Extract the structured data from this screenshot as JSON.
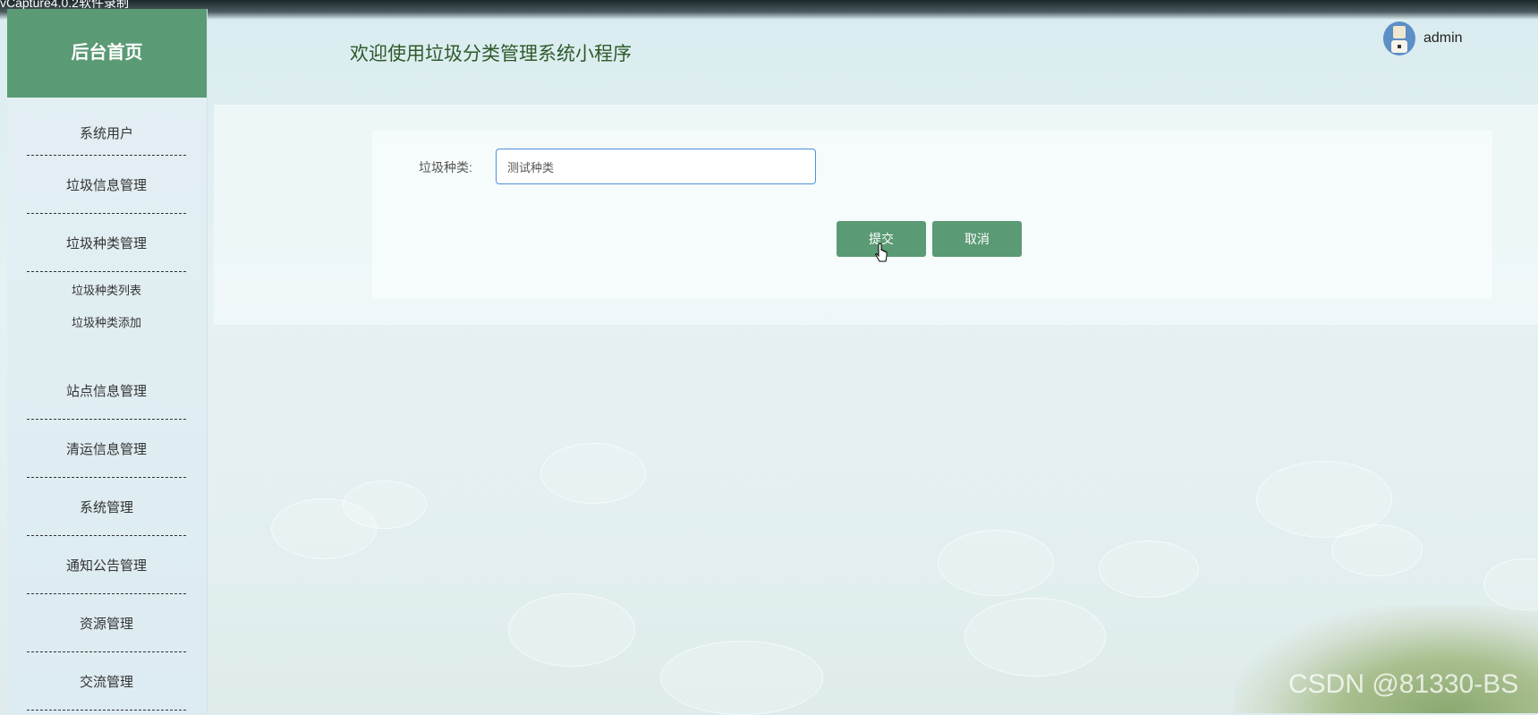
{
  "capture_label": "vCapture4.0.2软件录制",
  "sidebar": {
    "title": "后台首页",
    "items": [
      {
        "label": "系统用户"
      },
      {
        "label": "垃圾信息管理"
      },
      {
        "label": "垃圾种类管理"
      }
    ],
    "subitems": [
      {
        "label": "垃圾种类列表"
      },
      {
        "label": "垃圾种类添加"
      }
    ],
    "items_after": [
      {
        "label": "站点信息管理"
      },
      {
        "label": "清运信息管理"
      },
      {
        "label": "系统管理"
      },
      {
        "label": "通知公告管理"
      },
      {
        "label": "资源管理"
      },
      {
        "label": "交流管理"
      }
    ]
  },
  "header": {
    "welcome": "欢迎使用垃圾分类管理系统小程序",
    "username": "admin"
  },
  "form": {
    "category_label": "垃圾种类:",
    "category_value": "测试种类",
    "submit_label": "提交",
    "cancel_label": "取消"
  },
  "watermark": "CSDN @81330-BS",
  "colors": {
    "accent": "#5a9a74",
    "input_border": "#4a90d9",
    "welcome_text": "#2e5a2a"
  }
}
